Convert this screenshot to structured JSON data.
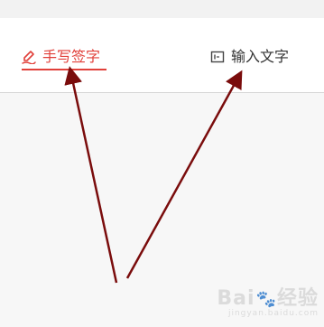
{
  "tabs": {
    "handwrite": {
      "label": "手写签字",
      "icon": "pen-sign-icon",
      "active": true,
      "color": "#e1403a"
    },
    "text": {
      "label": "输入文字",
      "icon": "text-box-icon",
      "active": false,
      "color": "#333333"
    }
  },
  "annotation": {
    "arrow_color": "#7a0c0c"
  },
  "watermark": {
    "main": "Bai",
    "after_paw": "经验",
    "sub": "jingyan.baidu.com"
  }
}
